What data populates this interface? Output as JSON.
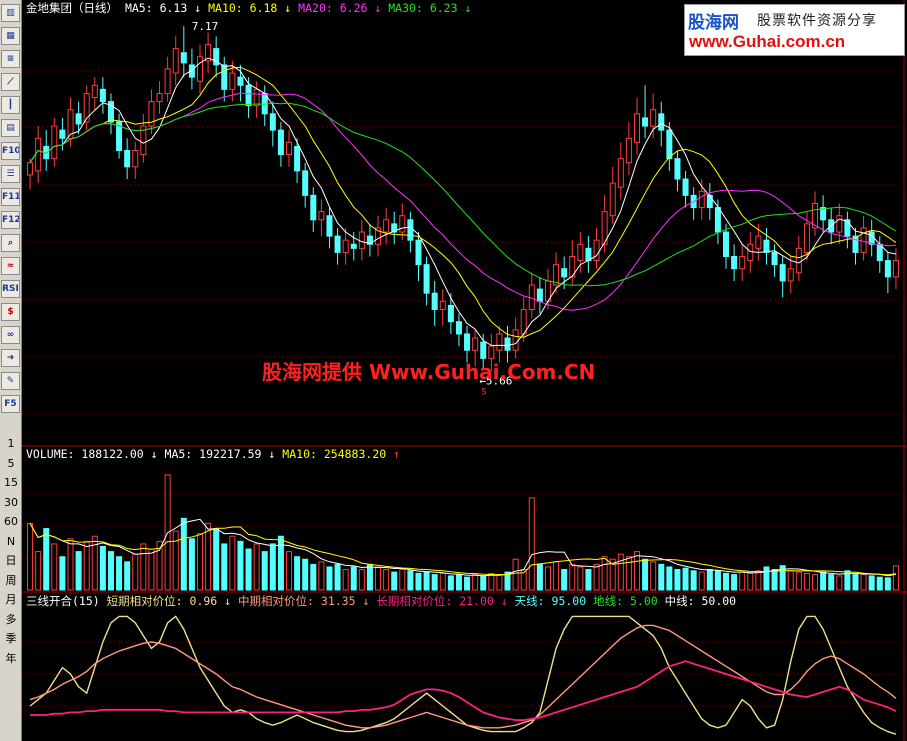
{
  "toolbar": {
    "buttons": [
      {
        "name": "kline-icon",
        "text": "▥",
        "red": false
      },
      {
        "name": "table-icon",
        "text": "▦",
        "red": false
      },
      {
        "name": "list-icon",
        "text": "≡",
        "red": false
      },
      {
        "name": "line-chart-icon",
        "text": "⟋",
        "red": false
      },
      {
        "name": "candle-icon",
        "text": "┃",
        "red": false
      },
      {
        "name": "report-icon",
        "text": "▤",
        "red": false
      },
      {
        "name": "f10-button",
        "text": "F10",
        "red": false
      },
      {
        "name": "news-icon",
        "text": "☰",
        "red": false
      },
      {
        "name": "f11-button",
        "text": "F11",
        "red": false
      },
      {
        "name": "f12-button",
        "text": "F12",
        "red": false
      },
      {
        "name": "search-icon",
        "text": "⌕",
        "red": false
      },
      {
        "name": "indicator-icon",
        "text": "≈",
        "red": true
      },
      {
        "name": "rsi-button",
        "text": "RSI",
        "red": false
      },
      {
        "name": "money-icon",
        "text": "$",
        "red": true
      },
      {
        "name": "link-icon",
        "text": "∞",
        "red": false
      },
      {
        "name": "exit-icon",
        "text": "➜",
        "red": false
      },
      {
        "name": "pen-icon",
        "text": "✎",
        "red": false
      },
      {
        "name": "f5-button",
        "text": "F5",
        "red": false
      }
    ],
    "periods": [
      "1",
      "5",
      "15",
      "30",
      "60",
      "N",
      "日",
      "周",
      "月",
      "多",
      "季",
      "年"
    ]
  },
  "logo": {
    "brand": "股海网",
    "slogan": "股票软件资源分享",
    "url": "www.Guhai.com.cn"
  },
  "watermark": "股海网提供 Www.Guhai.Com.CN",
  "price_header": {
    "title": "金地集团（日线）",
    "ma5_label": "MA5:",
    "ma5_value": "6.13",
    "ma5_arrow": "↓",
    "ma10_label": "MA10:",
    "ma10_value": "6.18",
    "ma10_arrow": "↓",
    "ma20_label": "MA20:",
    "ma20_value": "6.26",
    "ma20_arrow": "↓",
    "ma30_label": "MA30:",
    "ma30_value": "6.23",
    "ma30_arrow": "↓"
  },
  "price_annotations": {
    "high": "7.17",
    "low": "←5.66",
    "low_marker": "S"
  },
  "volume_header": {
    "title": "VOLUME:",
    "value": "188122.00",
    "arrow": "↓",
    "ma5_label": "MA5:",
    "ma5_value": "192217.59",
    "ma5_arrow": "↓",
    "ma10_label": "MA10:",
    "ma10_value": "254883.20",
    "ma10_arrow": "↑"
  },
  "indicator_header": {
    "title": "三线开合(15)",
    "short_label": "短期相对价位:",
    "short_value": "0.96",
    "short_arrow": "↓",
    "mid_label": "中期相对价位:",
    "mid_value": "31.35",
    "mid_arrow": "↓",
    "long_label": "长期相对价位:",
    "long_value": "21.00",
    "long_arrow": "↓",
    "sky_label": "天线:",
    "sky_value": "95.00",
    "ground_label": "地线:",
    "ground_value": "5.00",
    "center_label": "中线:",
    "center_value": "50.00"
  },
  "colors": {
    "up": "#ff3c3c",
    "down": "#54ffff",
    "ma5": "#ffffff",
    "ma10": "#ffff00",
    "ma20": "#ff30ff",
    "ma30": "#20e020",
    "grid": "#8b0000",
    "short": "#f0e08c",
    "mid": "#ff9a7a",
    "long": "#ff2080"
  },
  "chart_data": {
    "type": "candlestick",
    "price_range": [
      5.3,
      7.4
    ],
    "candles": [
      [
        6.62,
        6.68,
        6.55,
        6.7
      ],
      [
        6.64,
        6.8,
        6.58,
        6.86
      ],
      [
        6.76,
        6.7,
        6.64,
        6.84
      ],
      [
        6.7,
        6.86,
        6.66,
        6.9
      ],
      [
        6.84,
        6.8,
        6.74,
        6.9
      ],
      [
        6.8,
        6.94,
        6.76,
        7.0
      ],
      [
        6.92,
        6.87,
        6.82,
        6.98
      ],
      [
        6.88,
        7.02,
        6.84,
        7.06
      ],
      [
        7.0,
        7.06,
        6.94,
        7.1
      ],
      [
        7.04,
        6.98,
        6.92,
        7.1
      ],
      [
        6.98,
        6.88,
        6.82,
        7.02
      ],
      [
        6.88,
        6.74,
        6.7,
        6.92
      ],
      [
        6.74,
        6.66,
        6.6,
        6.8
      ],
      [
        6.66,
        6.74,
        6.6,
        6.78
      ],
      [
        6.72,
        6.86,
        6.68,
        6.92
      ],
      [
        6.86,
        6.98,
        6.82,
        7.04
      ],
      [
        6.98,
        7.02,
        6.92,
        7.08
      ],
      [
        7.02,
        7.14,
        6.98,
        7.2
      ],
      [
        7.12,
        7.24,
        7.06,
        7.3
      ],
      [
        7.22,
        7.17,
        7.1,
        7.35
      ],
      [
        7.16,
        7.1,
        7.04,
        7.24
      ],
      [
        7.08,
        7.2,
        7.02,
        7.26
      ],
      [
        7.18,
        7.26,
        7.12,
        7.32
      ],
      [
        7.24,
        7.16,
        7.1,
        7.3
      ],
      [
        7.16,
        7.04,
        6.98,
        7.2
      ],
      [
        7.04,
        7.12,
        6.98,
        7.18
      ],
      [
        7.1,
        7.06,
        6.98,
        7.16
      ],
      [
        7.06,
        6.96,
        6.9,
        7.1
      ],
      [
        6.96,
        7.04,
        6.9,
        7.08
      ],
      [
        7.02,
        6.92,
        6.86,
        7.06
      ],
      [
        6.92,
        6.84,
        6.76,
        6.98
      ],
      [
        6.84,
        6.72,
        6.66,
        6.88
      ],
      [
        6.72,
        6.78,
        6.66,
        6.84
      ],
      [
        6.76,
        6.64,
        6.58,
        6.8
      ],
      [
        6.64,
        6.52,
        6.46,
        6.68
      ],
      [
        6.52,
        6.4,
        6.34,
        6.56
      ],
      [
        6.4,
        6.44,
        6.32,
        6.5
      ],
      [
        6.42,
        6.32,
        6.26,
        6.46
      ],
      [
        6.32,
        6.24,
        6.18,
        6.36
      ],
      [
        6.24,
        6.3,
        6.18,
        6.36
      ],
      [
        6.28,
        6.26,
        6.2,
        6.34
      ],
      [
        6.26,
        6.34,
        6.2,
        6.4
      ],
      [
        6.32,
        6.28,
        6.22,
        6.38
      ],
      [
        6.28,
        6.36,
        6.22,
        6.42
      ],
      [
        6.34,
        6.4,
        6.28,
        6.46
      ],
      [
        6.38,
        6.34,
        6.28,
        6.44
      ],
      [
        6.34,
        6.42,
        6.3,
        6.48
      ],
      [
        6.4,
        6.3,
        6.24,
        6.44
      ],
      [
        6.3,
        6.18,
        6.1,
        6.34
      ],
      [
        6.18,
        6.04,
        5.98,
        6.22
      ],
      [
        6.04,
        5.96,
        5.88,
        6.1
      ],
      [
        5.96,
        6.0,
        5.88,
        6.06
      ],
      [
        5.98,
        5.9,
        5.84,
        6.04
      ],
      [
        5.9,
        5.84,
        5.78,
        5.94
      ],
      [
        5.84,
        5.76,
        5.7,
        5.88
      ],
      [
        5.76,
        5.82,
        5.68,
        5.86
      ],
      [
        5.8,
        5.72,
        5.66,
        5.84
      ],
      [
        5.72,
        5.78,
        5.66,
        5.84
      ],
      [
        5.76,
        5.84,
        5.7,
        5.88
      ],
      [
        5.82,
        5.76,
        5.7,
        5.88
      ],
      [
        5.76,
        5.86,
        5.72,
        5.92
      ],
      [
        5.84,
        5.96,
        5.8,
        6.02
      ],
      [
        5.96,
        6.08,
        5.92,
        6.14
      ],
      [
        6.06,
        6.0,
        5.94,
        6.12
      ],
      [
        6.0,
        6.1,
        5.96,
        6.16
      ],
      [
        6.08,
        6.18,
        6.04,
        6.24
      ],
      [
        6.16,
        6.12,
        6.06,
        6.22
      ],
      [
        6.12,
        6.22,
        6.08,
        6.3
      ],
      [
        6.2,
        6.28,
        6.14,
        6.34
      ],
      [
        6.26,
        6.2,
        6.14,
        6.32
      ],
      [
        6.2,
        6.3,
        6.16,
        6.36
      ],
      [
        6.28,
        6.44,
        6.24,
        6.52
      ],
      [
        6.42,
        6.58,
        6.38,
        6.66
      ],
      [
        6.56,
        6.7,
        6.5,
        6.78
      ],
      [
        6.68,
        6.8,
        6.62,
        6.88
      ],
      [
        6.78,
        6.92,
        6.72,
        7.0
      ],
      [
        6.9,
        6.86,
        6.8,
        7.06
      ],
      [
        6.86,
        6.94,
        6.8,
        7.02
      ],
      [
        6.92,
        6.84,
        6.76,
        6.98
      ],
      [
        6.84,
        6.7,
        6.64,
        6.88
      ],
      [
        6.7,
        6.6,
        6.54,
        6.74
      ],
      [
        6.6,
        6.52,
        6.46,
        6.64
      ],
      [
        6.52,
        6.46,
        6.4,
        6.56
      ],
      [
        6.46,
        6.54,
        6.4,
        6.6
      ],
      [
        6.52,
        6.46,
        6.4,
        6.58
      ],
      [
        6.46,
        6.34,
        6.28,
        6.5
      ],
      [
        6.34,
        6.22,
        6.16,
        6.38
      ],
      [
        6.22,
        6.16,
        6.1,
        6.28
      ],
      [
        6.16,
        6.22,
        6.1,
        6.28
      ],
      [
        6.2,
        6.28,
        6.14,
        6.34
      ],
      [
        6.26,
        6.32,
        6.2,
        6.38
      ],
      [
        6.3,
        6.24,
        6.18,
        6.36
      ],
      [
        6.24,
        6.18,
        6.12,
        6.28
      ],
      [
        6.18,
        6.1,
        6.02,
        6.22
      ],
      [
        6.1,
        6.16,
        6.04,
        6.22
      ],
      [
        6.14,
        6.26,
        6.1,
        6.32
      ],
      [
        6.24,
        6.38,
        6.2,
        6.44
      ],
      [
        6.36,
        6.48,
        6.32,
        6.54
      ],
      [
        6.46,
        6.4,
        6.34,
        6.52
      ],
      [
        6.4,
        6.34,
        6.28,
        6.46
      ],
      [
        6.34,
        6.42,
        6.28,
        6.48
      ],
      [
        6.4,
        6.32,
        6.26,
        6.44
      ],
      [
        6.32,
        6.24,
        6.18,
        6.36
      ],
      [
        6.24,
        6.36,
        6.2,
        6.42
      ],
      [
        6.34,
        6.28,
        6.22,
        6.4
      ],
      [
        6.28,
        6.2,
        6.14,
        6.32
      ],
      [
        6.2,
        6.12,
        6.04,
        6.24
      ],
      [
        6.12,
        6.2,
        6.06,
        6.26
      ]
    ],
    "volume_range": [
      0,
      1000000
    ],
    "volume": [
      520000,
      300000,
      480000,
      360000,
      260000,
      400000,
      300000,
      380000,
      420000,
      340000,
      300000,
      260000,
      220000,
      280000,
      360000,
      320000,
      380000,
      900000,
      460000,
      560000,
      400000,
      440000,
      520000,
      480000,
      360000,
      420000,
      380000,
      320000,
      360000,
      300000,
      360000,
      420000,
      300000,
      260000,
      240000,
      200000,
      220000,
      180000,
      200000,
      160000,
      180000,
      160000,
      200000,
      180000,
      160000,
      140000,
      160000,
      150000,
      130000,
      140000,
      120000,
      130000,
      110000,
      120000,
      100000,
      120000,
      110000,
      130000,
      120000,
      140000,
      240000,
      160000,
      720000,
      200000,
      180000,
      220000,
      160000,
      200000,
      180000,
      160000,
      200000,
      260000,
      240000,
      280000,
      260000,
      300000,
      240000,
      220000,
      200000,
      180000,
      160000,
      170000,
      150000,
      140000,
      160000,
      150000,
      130000,
      120000,
      140000,
      130000,
      150000,
      180000,
      160000,
      190000,
      150000,
      140000,
      130000,
      120000,
      140000,
      120000,
      110000,
      150000,
      130000,
      120000,
      110000,
      100000,
      95000,
      188122
    ],
    "indicator_range": [
      0,
      100
    ],
    "short": [
      25,
      30,
      35,
      45,
      55,
      50,
      40,
      35,
      55,
      75,
      90,
      95,
      95,
      90,
      80,
      70,
      75,
      90,
      95,
      85,
      70,
      55,
      45,
      35,
      25,
      20,
      22,
      20,
      15,
      12,
      10,
      12,
      15,
      18,
      15,
      12,
      10,
      8,
      6,
      5,
      5,
      6,
      8,
      10,
      12,
      15,
      20,
      25,
      30,
      35,
      30,
      25,
      20,
      15,
      10,
      8,
      6,
      5,
      5,
      5,
      5,
      8,
      12,
      20,
      45,
      70,
      85,
      95,
      95,
      95,
      95,
      95,
      95,
      95,
      95,
      90,
      85,
      80,
      70,
      55,
      45,
      35,
      25,
      15,
      10,
      8,
      10,
      20,
      30,
      25,
      15,
      8,
      10,
      30,
      60,
      85,
      95,
      95,
      85,
      70,
      55,
      40,
      30,
      20,
      12,
      8,
      5,
      3
    ],
    "mid": [
      30,
      32,
      35,
      38,
      42,
      45,
      48,
      52,
      58,
      62,
      65,
      68,
      70,
      72,
      74,
      75,
      74,
      72,
      70,
      66,
      62,
      58,
      54,
      50,
      45,
      40,
      38,
      35,
      32,
      30,
      28,
      26,
      24,
      22,
      20,
      18,
      16,
      14,
      12,
      10,
      9,
      8,
      8,
      9,
      10,
      12,
      14,
      16,
      18,
      20,
      18,
      16,
      14,
      12,
      10,
      9,
      8,
      8,
      8,
      9,
      10,
      12,
      14,
      18,
      24,
      30,
      36,
      42,
      48,
      54,
      60,
      66,
      72,
      78,
      82,
      86,
      88,
      88,
      86,
      84,
      80,
      76,
      72,
      68,
      64,
      60,
      56,
      52,
      48,
      44,
      40,
      36,
      34,
      34,
      38,
      44,
      52,
      58,
      62,
      64,
      62,
      58,
      54,
      50,
      45,
      40,
      36,
      31
    ],
    "long": [
      18,
      18,
      18,
      19,
      19,
      20,
      20,
      21,
      21,
      22,
      22,
      22,
      22,
      22,
      22,
      22,
      22,
      21,
      21,
      20,
      20,
      20,
      20,
      20,
      20,
      20,
      20,
      20,
      20,
      20,
      20,
      20,
      20,
      20,
      20,
      20,
      20,
      20,
      20,
      21,
      21,
      22,
      22,
      23,
      24,
      26,
      30,
      34,
      36,
      38,
      38,
      37,
      35,
      32,
      28,
      24,
      20,
      18,
      16,
      15,
      14,
      14,
      15,
      16,
      18,
      20,
      22,
      24,
      26,
      28,
      30,
      32,
      34,
      36,
      38,
      40,
      44,
      48,
      52,
      56,
      58,
      60,
      58,
      56,
      54,
      52,
      50,
      48,
      46,
      44,
      42,
      40,
      38,
      36,
      34,
      33,
      32,
      34,
      36,
      38,
      40,
      38,
      34,
      30,
      28,
      26,
      24,
      21
    ]
  }
}
